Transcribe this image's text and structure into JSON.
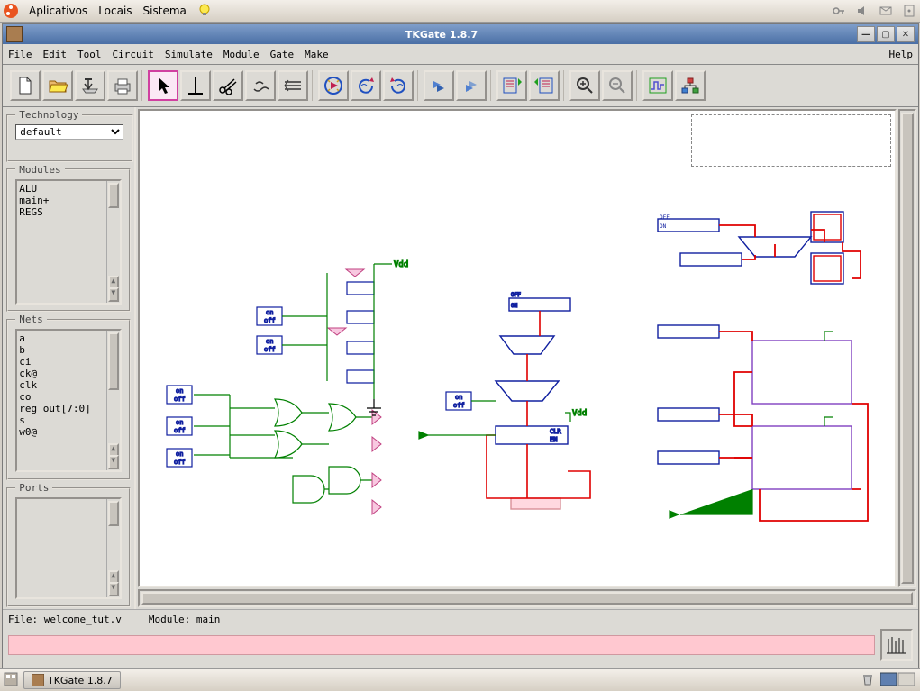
{
  "gnome": {
    "menu1": "Aplicativos",
    "menu2": "Locais",
    "menu3": "Sistema"
  },
  "window": {
    "title": "TKGate 1.8.7"
  },
  "menu": {
    "file": "File",
    "edit": "Edit",
    "tool": "Tool",
    "circuit": "Circuit",
    "simulate": "Simulate",
    "module": "Module",
    "gate": "Gate",
    "make": "Make",
    "help": "Help"
  },
  "panels": {
    "tech": "Technology",
    "tech_value": "default",
    "modules": "Modules",
    "nets": "Nets",
    "ports": "Ports"
  },
  "modules": [
    "ALU",
    "main+",
    "REGS"
  ],
  "nets": [
    "a",
    "b",
    "ci",
    "ck@",
    "clk",
    "co",
    "reg_out[7:0]",
    "s",
    "w0@"
  ],
  "status": {
    "file_label": "File:",
    "file_value": "welcome_tut.v",
    "module_label": "Module:",
    "module_value": "main"
  },
  "taskbar": {
    "item": "TKGate 1.8.7"
  }
}
